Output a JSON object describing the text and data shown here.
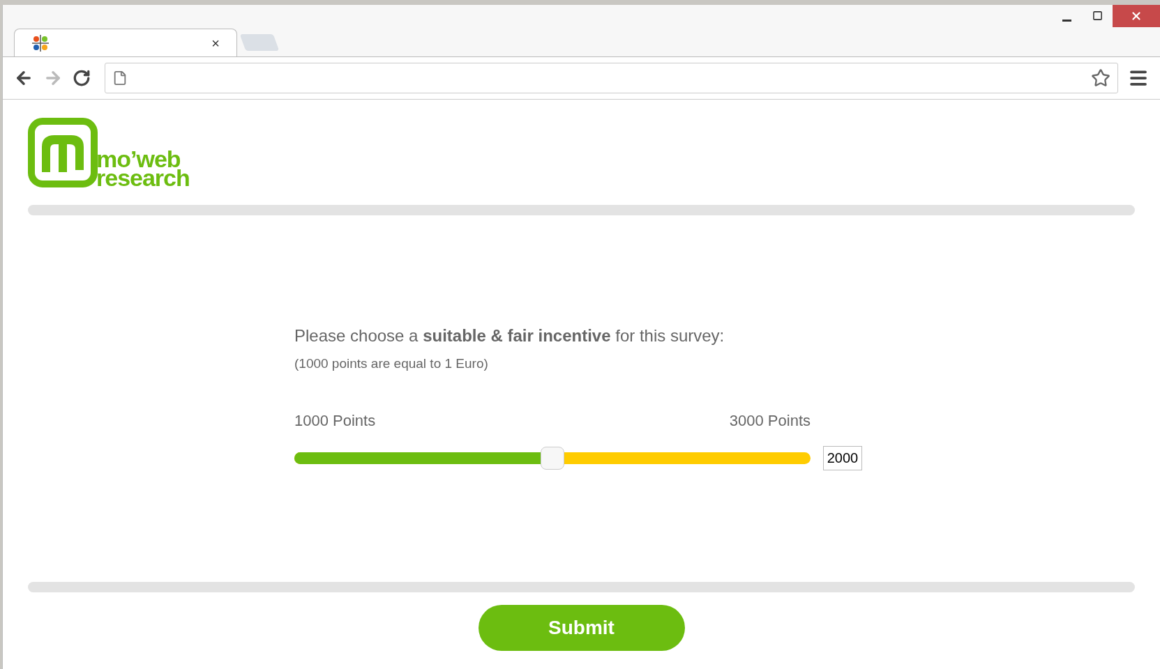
{
  "browser": {
    "tabs": [
      {
        "kind": "page",
        "selected": true,
        "close": "×"
      },
      {
        "kind": "new",
        "selected": false
      }
    ]
  },
  "logo": {
    "line_1": "mo’web",
    "line_2": "research"
  },
  "question": {
    "text": "Please choose a **suitable & fair incentive** for this survey:",
    "note": "(1000 points are equal to 1 Euro)"
  },
  "slider": {
    "min_label": "1000 Points",
    "max_label": "3000 Points",
    "level": 0.5,
    "value": "2000"
  },
  "submit": "Submit"
}
